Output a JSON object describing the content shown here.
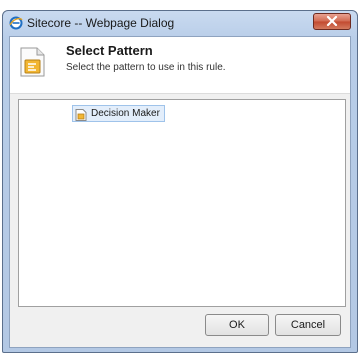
{
  "window": {
    "title": "Sitecore -- Webpage Dialog",
    "title_icon": "ie-globe-icon",
    "close_icon": "close-icon"
  },
  "header": {
    "icon": "pattern-document-icon",
    "title": "Select Pattern",
    "subtitle": "Select the pattern to use in this rule."
  },
  "tree": {
    "items": [
      {
        "label": "Decision Maker",
        "icon": "pattern-item-icon",
        "selected": true
      }
    ]
  },
  "buttons": {
    "ok_label": "OK",
    "cancel_label": "Cancel"
  },
  "colors": {
    "titlebar": "#b8cde8",
    "close": "#c9553b",
    "selection": "#e3eefb"
  }
}
